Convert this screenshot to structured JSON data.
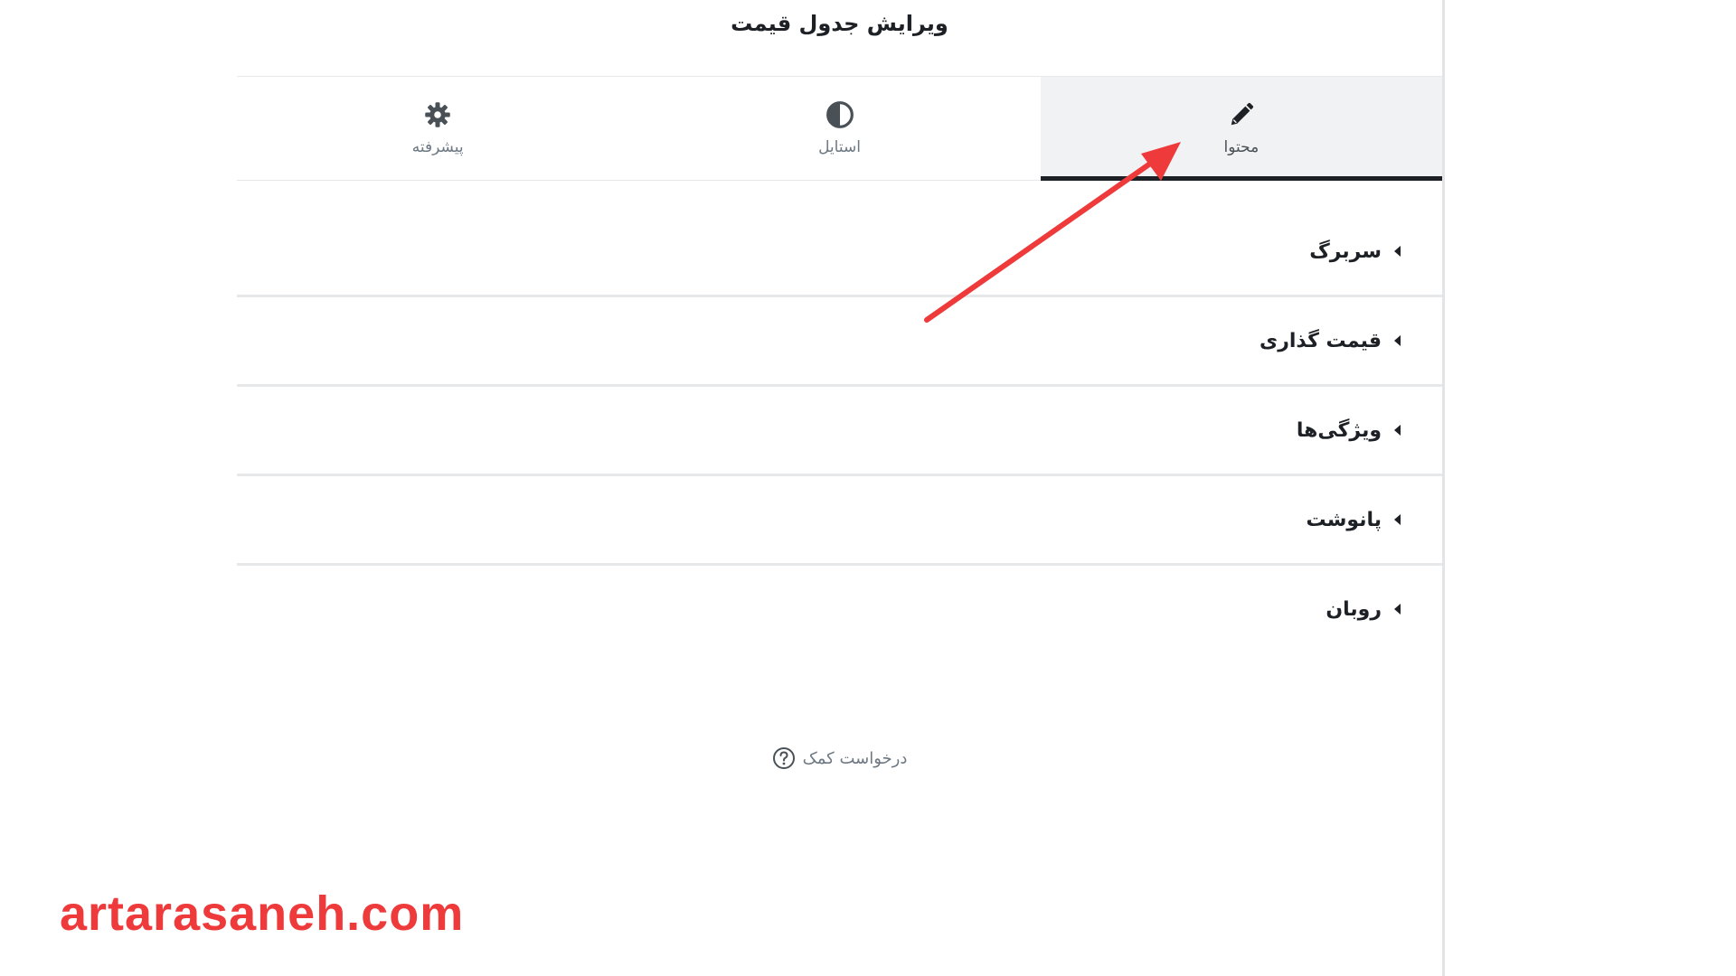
{
  "panel": {
    "title": "ویرایش جدول قیمت"
  },
  "tabs": [
    {
      "label": "محتوا",
      "icon": "pencil-icon",
      "active": true
    },
    {
      "label": "استایل",
      "icon": "half-circle-icon",
      "active": false
    },
    {
      "label": "پیشرفته",
      "icon": "gear-icon",
      "active": false
    }
  ],
  "sections": [
    {
      "label": "سربرگ"
    },
    {
      "label": "قیمت گذاری"
    },
    {
      "label": "ویژگی‌ها"
    },
    {
      "label": "پانوشت"
    },
    {
      "label": "روبان"
    }
  ],
  "help": {
    "label": "درخواست کمک",
    "icon": "question-circle-icon"
  },
  "watermark": {
    "text": "artarasaneh.com"
  },
  "colors": {
    "accent_arrow": "#ee3a3b",
    "active_tab_bg": "#f1f2f3",
    "active_tab_underline": "#1d2125"
  }
}
